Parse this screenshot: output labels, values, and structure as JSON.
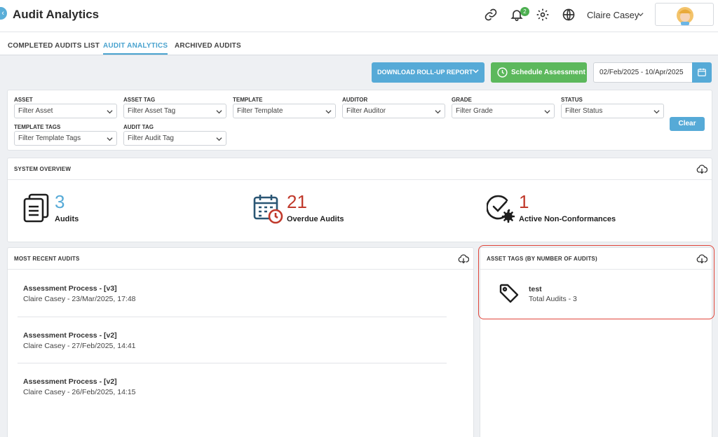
{
  "app": {
    "title": "Audit Analytics"
  },
  "header": {
    "notifications_count": "2",
    "user_name": "Claire Casey"
  },
  "tabs": [
    {
      "label": "COMPLETED AUDITS LIST"
    },
    {
      "label": "AUDIT ANALYTICS",
      "active": true
    },
    {
      "label": "ARCHIVED AUDITS"
    }
  ],
  "actions": {
    "download_label": "DOWNLOAD ROLL-UP REPORT",
    "schedule_label": "Schedule Assessment",
    "date_range": "02/Feb/2025 - 10/Apr/2025"
  },
  "filters": [
    {
      "label": "ASSET",
      "placeholder": "Filter Asset"
    },
    {
      "label": "ASSET TAG",
      "placeholder": "Filter Asset Tag"
    },
    {
      "label": "TEMPLATE",
      "placeholder": "Filter Template"
    },
    {
      "label": "AUDITOR",
      "placeholder": "Filter Auditor"
    },
    {
      "label": "GRADE",
      "placeholder": "Filter Grade"
    },
    {
      "label": "STATUS",
      "placeholder": "Filter Status"
    },
    {
      "label": "TEMPLATE TAGS",
      "placeholder": "Filter Template Tags"
    },
    {
      "label": "AUDIT TAG",
      "placeholder": "Filter Audit Tag"
    }
  ],
  "clear_label": "Clear",
  "overview": {
    "title": "SYSTEM OVERVIEW",
    "stats": [
      {
        "value": "3",
        "label": "Audits",
        "color": "#56aad7",
        "icon": "clipboard-icon"
      },
      {
        "value": "21",
        "label": "Overdue Audits",
        "color": "#c0392b",
        "icon": "calendar-clock-icon"
      },
      {
        "value": "1",
        "label": "Active Non-Conformances",
        "color": "#c0392b",
        "icon": "check-gear-icon"
      }
    ]
  },
  "recent": {
    "title": "MOST RECENT AUDITS",
    "items": [
      {
        "title": "Assessment Process - [v3]",
        "sub": "Claire Casey - 23/Mar/2025, 17:48"
      },
      {
        "title": "Assessment Process - [v2]",
        "sub": "Claire Casey - 27/Feb/2025, 14:41"
      },
      {
        "title": "Assessment Process - [v2]",
        "sub": "Claire Casey - 26/Feb/2025, 14:15"
      }
    ]
  },
  "asset_tags": {
    "title": "ASSET TAGS (BY NUMBER OF AUDITS)",
    "items": [
      {
        "name": "test",
        "sub": "Total Audits - 3"
      }
    ]
  },
  "colors": {
    "accent": "#56aad7",
    "success": "#5cb85c",
    "danger": "#c0392b",
    "highlight": "#e0453a"
  }
}
